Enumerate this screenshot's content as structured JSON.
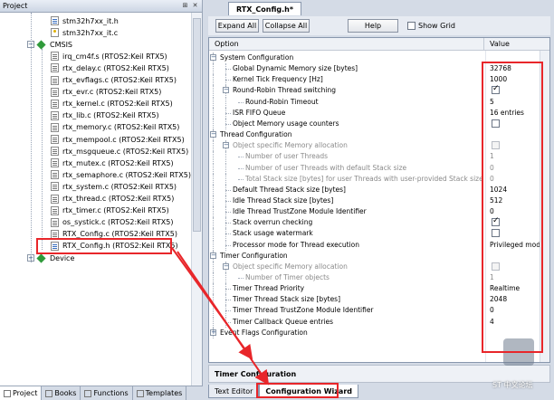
{
  "project_panel": {
    "title": "Project",
    "header_buttons": [
      "pin-icon",
      "close-icon"
    ],
    "tree": [
      {
        "label": "stm32h7xx_it.h",
        "icon": "header-file-icon",
        "indent": 2
      },
      {
        "label": "stm32h7xx_it.c",
        "icon": "locked-file-icon",
        "indent": 2
      },
      {
        "label": "CMSIS",
        "icon": "component-gem-icon",
        "indent": 1,
        "expanded": true
      },
      {
        "label": "irq_cm4f.s (RTOS2:Keil RTX5)",
        "icon": "file-icon",
        "indent": 2
      },
      {
        "label": "rtx_delay.c (RTOS2:Keil RTX5)",
        "icon": "file-icon",
        "indent": 2
      },
      {
        "label": "rtx_evflags.c (RTOS2:Keil RTX5)",
        "icon": "file-icon",
        "indent": 2
      },
      {
        "label": "rtx_evr.c (RTOS2:Keil RTX5)",
        "icon": "file-icon",
        "indent": 2
      },
      {
        "label": "rtx_kernel.c (RTOS2:Keil RTX5)",
        "icon": "file-icon",
        "indent": 2
      },
      {
        "label": "rtx_lib.c (RTOS2:Keil RTX5)",
        "icon": "file-icon",
        "indent": 2
      },
      {
        "label": "rtx_memory.c (RTOS2:Keil RTX5)",
        "icon": "file-icon",
        "indent": 2
      },
      {
        "label": "rtx_mempool.c (RTOS2:Keil RTX5)",
        "icon": "file-icon",
        "indent": 2
      },
      {
        "label": "rtx_msgqueue.c (RTOS2:Keil RTX5)",
        "icon": "file-icon",
        "indent": 2
      },
      {
        "label": "rtx_mutex.c (RTOS2:Keil RTX5)",
        "icon": "file-icon",
        "indent": 2
      },
      {
        "label": "rtx_semaphore.c (RTOS2:Keil RTX5)",
        "icon": "file-icon",
        "indent": 2
      },
      {
        "label": "rtx_system.c (RTOS2:Keil RTX5)",
        "icon": "file-icon",
        "indent": 2
      },
      {
        "label": "rtx_thread.c (RTOS2:Keil RTX5)",
        "icon": "file-icon",
        "indent": 2
      },
      {
        "label": "rtx_timer.c (RTOS2:Keil RTX5)",
        "icon": "file-icon",
        "indent": 2
      },
      {
        "label": "os_systick.c (RTOS2:Keil RTX5)",
        "icon": "file-icon",
        "indent": 2
      },
      {
        "label": "RTX_Config.c (RTOS2:Keil RTX5)",
        "icon": "file-icon",
        "indent": 2
      },
      {
        "label": "RTX_Config.h (RTOS2:Keil RTX5)",
        "icon": "header-file-icon",
        "indent": 2
      },
      {
        "label": "Device",
        "icon": "component-gem-icon",
        "indent": 1,
        "expanded": false
      }
    ],
    "tabs": [
      {
        "label": "Project",
        "icon": "project-icon",
        "active": true
      },
      {
        "label": "Books",
        "icon": "books-icon",
        "active": false
      },
      {
        "label": "Functions",
        "icon": "functions-icon",
        "active": false
      },
      {
        "label": "Templates",
        "icon": "templates-icon",
        "active": false
      }
    ]
  },
  "editor": {
    "active_tab": "RTX_Config.h*",
    "toolbar": {
      "expand_all": "Expand All",
      "collapse_all": "Collapse All",
      "help": "Help",
      "show_grid": "Show Grid",
      "show_grid_checked": false
    },
    "columns": {
      "option": "Option",
      "value": "Value"
    },
    "rows": [
      {
        "label": "System Configuration",
        "level": 0,
        "toggle": "minus"
      },
      {
        "label": "Global Dynamic Memory size [bytes]",
        "level": 1,
        "value": "32768"
      },
      {
        "label": "Kernel Tick Frequency [Hz]",
        "level": 1,
        "value": "1000"
      },
      {
        "label": "Round-Robin Thread switching",
        "level": 1,
        "toggle": "minus",
        "check": "on"
      },
      {
        "label": "Round-Robin Timeout",
        "level": 2,
        "value": "5"
      },
      {
        "label": "ISR FIFO Queue",
        "level": 1,
        "value": "16 entries"
      },
      {
        "label": "Object Memory usage counters",
        "level": 1,
        "check": "off"
      },
      {
        "label": "Thread Configuration",
        "level": 0,
        "toggle": "minus"
      },
      {
        "label": "Object specific Memory allocation",
        "level": 1,
        "toggle": "minus",
        "check": "off",
        "dim": true
      },
      {
        "label": "Number of user Threads",
        "level": 2,
        "value": "1",
        "dim": true
      },
      {
        "label": "Number of user Threads with default Stack size",
        "level": 2,
        "value": "0",
        "dim": true
      },
      {
        "label": "Total Stack size [bytes] for user Threads with user-provided Stack size",
        "level": 2,
        "value": "0",
        "dim": true
      },
      {
        "label": "Default Thread Stack size [bytes]",
        "level": 1,
        "value": "1024"
      },
      {
        "label": "Idle Thread Stack size [bytes]",
        "level": 1,
        "value": "512"
      },
      {
        "label": "Idle Thread TrustZone Module Identifier",
        "level": 1,
        "value": "0"
      },
      {
        "label": "Stack overrun checking",
        "level": 1,
        "check": "on"
      },
      {
        "label": "Stack usage watermark",
        "level": 1,
        "check": "off"
      },
      {
        "label": "Processor mode for Thread execution",
        "level": 1,
        "value": "Privileged mode"
      },
      {
        "label": "Timer Configuration",
        "level": 0,
        "toggle": "minus"
      },
      {
        "label": "Object specific Memory allocation",
        "level": 1,
        "toggle": "minus",
        "check": "off",
        "dim": true
      },
      {
        "label": "Number of Timer objects",
        "level": 2,
        "value": "1",
        "dim": true
      },
      {
        "label": "Timer Thread Priority",
        "level": 1,
        "value": "Realtime"
      },
      {
        "label": "Timer Thread Stack size [bytes]",
        "level": 1,
        "value": "2048"
      },
      {
        "label": "Timer Thread TrustZone Module Identifier",
        "level": 1,
        "value": "0"
      },
      {
        "label": "Timer Callback Queue entries",
        "level": 1,
        "value": "4"
      },
      {
        "label": "Event Flags Configuration",
        "level": 0,
        "toggle": "plus"
      }
    ],
    "description": "Timer Configuration",
    "bottom_tabs": [
      {
        "label": "Text Editor",
        "active": false
      },
      {
        "label": "Configuration Wizard",
        "active": true
      }
    ]
  },
  "watermark": {
    "text": "ST 中文论坛"
  },
  "colors": {
    "annotation_red": "#e8262a",
    "checked_gem_green": "#2f9a3a"
  }
}
